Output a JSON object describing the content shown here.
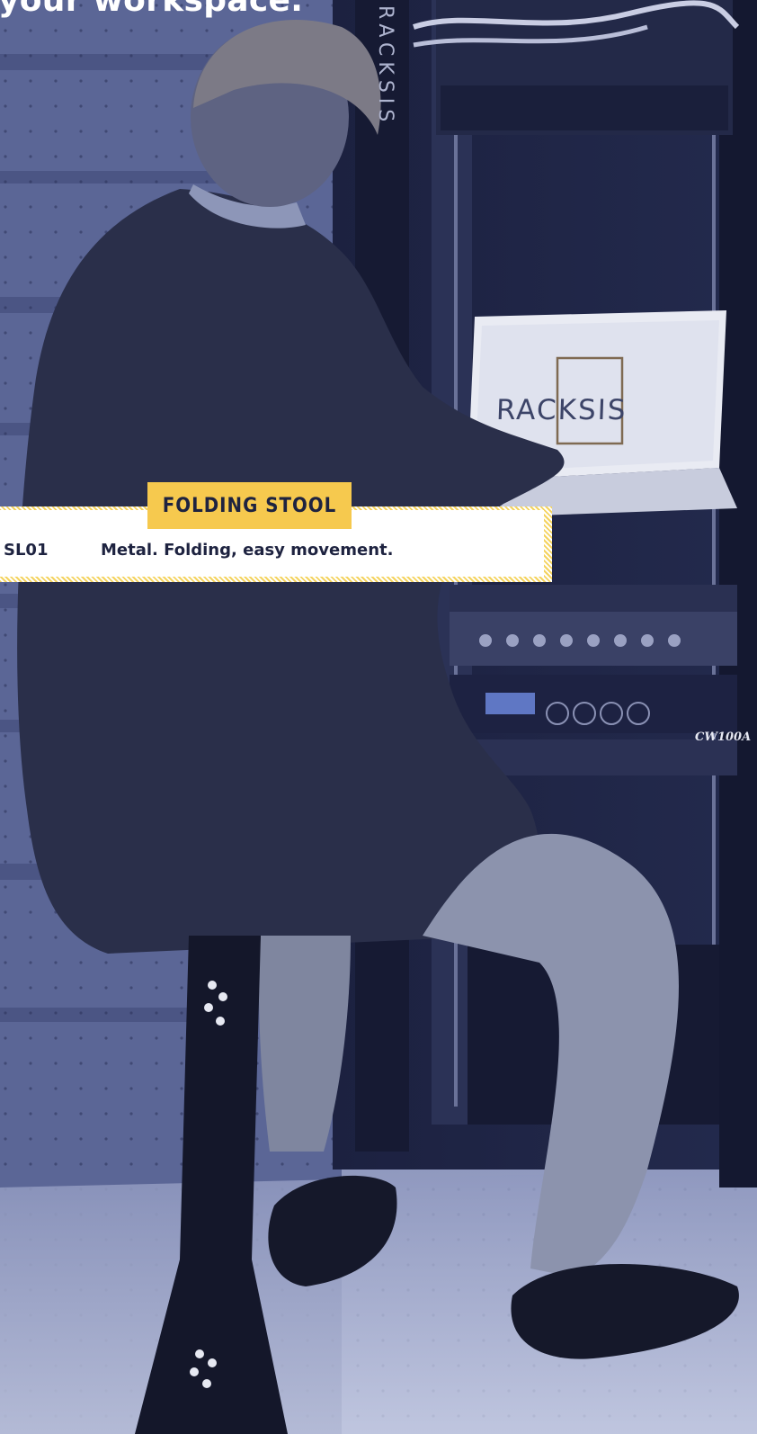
{
  "headline": "your workspace.",
  "product": {
    "category": "FOLDING STOOL",
    "code": "SL01",
    "description": "Metal. Folding, easy movement."
  },
  "scene": {
    "laptop_logo": "RACKSIS",
    "rack_brand": "RACKSIS",
    "amplifier_model": "CW100A"
  },
  "colors": {
    "accent_yellow": "#f6c94e",
    "overlay_navy": "#3b4470",
    "text_dark": "#1e2340"
  }
}
